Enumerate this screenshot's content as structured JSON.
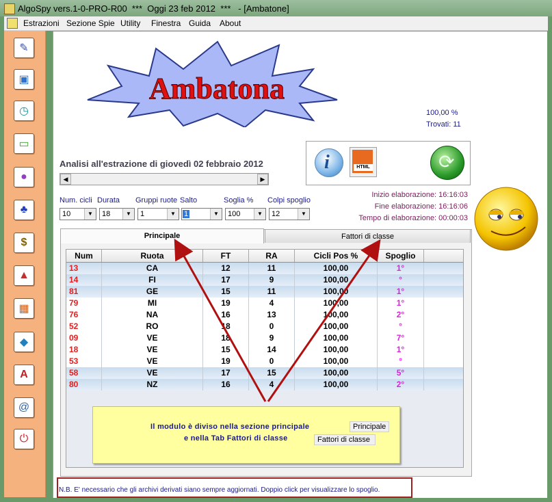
{
  "window": {
    "title": "AlgoSpy vers.1-0-PRO-R00  ***  Oggi 23 feb 2012  ***   - [Ambatone]"
  },
  "menu": [
    "Estrazioni",
    "Sezione Spie",
    "Utility",
    "Finestra",
    "Guida",
    "About"
  ],
  "sidebar_icons": [
    "pencil-icon",
    "book-icon",
    "clock-icon",
    "battery-icon",
    "lightbulb-icon",
    "lottery-icon",
    "dollar-icon",
    "pyramid-icon",
    "calendar-icon",
    "shape-icon",
    "letter-a-icon",
    "address-book-icon",
    "power-icon"
  ],
  "logo": {
    "text": "Ambatona"
  },
  "stats": {
    "percent": "100,00 %",
    "found": "Trovati: 11"
  },
  "analysis_title": "Analisi all'estrazione di giovedì 02 febbraio 2012",
  "toolbox": {
    "info_icon": "info-icon",
    "html_icon": "html-file-icon",
    "refresh_icon": "refresh-icon",
    "html_label": "HTML"
  },
  "elaboration": {
    "start": "Inizio elaborazione: 16:16:03",
    "end": "Fine elaborazione: 16:16:06",
    "time": "Tempo di elaborazione: 00:00:03"
  },
  "filters": {
    "labels": [
      "Num. cicli",
      "Durata",
      "Gruppi ruote",
      "Salto",
      "Soglia %",
      "Colpi spoglio"
    ],
    "values": [
      "10",
      "18",
      "1",
      "1",
      "100",
      "12"
    ]
  },
  "tabs": {
    "principale": "Principale",
    "fattori": "Fattori di classe"
  },
  "table": {
    "headers": [
      "Num",
      "Ruota",
      "FT",
      "RA",
      "Cicli Pos %",
      "Spoglio"
    ],
    "rows": [
      [
        "13",
        "CA",
        "12",
        "11",
        "100,00",
        "1°"
      ],
      [
        "14",
        "FI",
        "17",
        "9",
        "100,00",
        "°"
      ],
      [
        "81",
        "GE",
        "15",
        "11",
        "100,00",
        "1°"
      ],
      [
        "79",
        "MI",
        "19",
        "4",
        "100,00",
        "1°"
      ],
      [
        "76",
        "NA",
        "16",
        "13",
        "100,00",
        "2°"
      ],
      [
        "52",
        "RO",
        "18",
        "0",
        "100,00",
        "°"
      ],
      [
        "09",
        "VE",
        "18",
        "9",
        "100,00",
        "7°"
      ],
      [
        "18",
        "VE",
        "15",
        "14",
        "100,00",
        "1°"
      ],
      [
        "53",
        "VE",
        "19",
        "0",
        "100,00",
        "°"
      ],
      [
        "58",
        "VE",
        "17",
        "15",
        "100,00",
        "5°"
      ],
      [
        "80",
        "NZ",
        "16",
        "4",
        "100,00",
        "2°"
      ]
    ]
  },
  "note": {
    "line1": "Il modulo è diviso nella sezione principale",
    "line2": "e nella Tab Fattori di classe",
    "btn1": "Principale",
    "btn2": "Fattori di classe"
  },
  "footer": "N.B. E' necessario che gli archivi derivati siano sempre aggiornati. Doppio click per visualizzare lo spoglio.",
  "colors": {
    "num": "#e02020",
    "spoglio": "#e020e0",
    "accent": "#1a1a8a"
  }
}
